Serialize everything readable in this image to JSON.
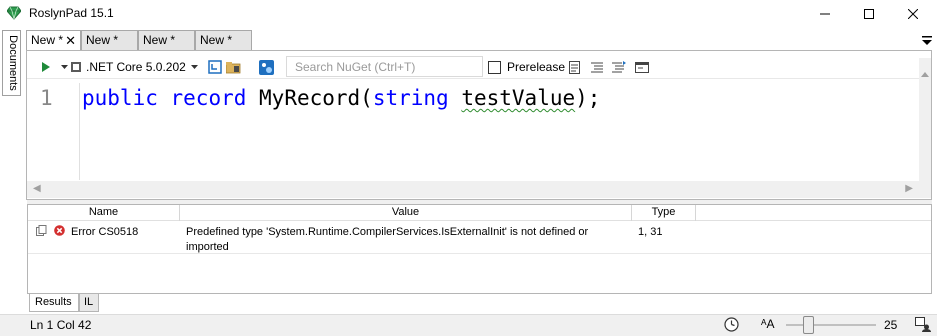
{
  "window": {
    "title": "RoslynPad 15.1"
  },
  "side_panel": {
    "documents_label": "Documents"
  },
  "tabs": [
    {
      "label": "New *",
      "active": true
    },
    {
      "label": "New *",
      "active": false
    },
    {
      "label": "New *",
      "active": false
    },
    {
      "label": "New *",
      "active": false
    }
  ],
  "toolbar": {
    "framework": ".NET Core 5.0.202",
    "search_placeholder": "Search NuGet (Ctrl+T)",
    "prerelease_label": "Prerelease",
    "prerelease_checked": false
  },
  "editor": {
    "line_number": "1",
    "tokens": {
      "kw_public": "public",
      "kw_record": "record",
      "type_name": "MyRecord(",
      "kw_string": "string",
      "param_name": "testValue",
      "tail": ");"
    }
  },
  "results": {
    "columns": [
      "Name",
      "Value",
      "Type"
    ],
    "rows": [
      {
        "name": "Error  CS0518",
        "value_line1": "Predefined type 'System.Runtime.CompilerServices.IsExternalInit' is not defined or",
        "value_line2": "imported",
        "type": "1, 31"
      }
    ],
    "bottom_tabs": [
      "Results",
      "IL"
    ]
  },
  "status": {
    "position": "Ln 1 Col 42",
    "zoom": "25",
    "font_icon_label": "A"
  },
  "colors": {
    "keyword": "#0000ff",
    "error": "#d32f2f",
    "app_icon": "#2e9e4f",
    "squiggle": "#2e8b2e"
  },
  "icons": [
    "app-gem-icon",
    "minimize-icon",
    "maximize-icon",
    "close-icon",
    "run-icon",
    "restore-packages-icon",
    "folder-icon",
    "nuget-icon",
    "copy-icon",
    "error-icon",
    "clock-icon",
    "font-size-icon",
    "feedback-icon"
  ]
}
